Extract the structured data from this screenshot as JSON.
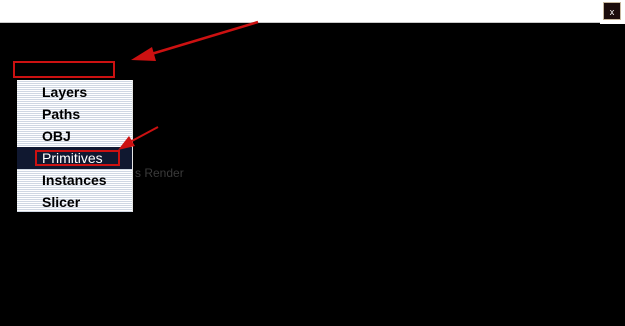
{
  "window": {
    "close_label": "x"
  },
  "menu": {
    "items": [
      {
        "label": "Layers",
        "selected": false
      },
      {
        "label": "Paths",
        "selected": false
      },
      {
        "label": "OBJ",
        "selected": false
      },
      {
        "label": "Primitives",
        "selected": true
      },
      {
        "label": "Instances",
        "selected": false
      },
      {
        "label": "Slicer",
        "selected": false
      }
    ]
  },
  "background": {
    "partial_text": "s Render"
  },
  "colors": {
    "annotation": "#cc1111",
    "background": "#000000",
    "selected_item_bg": "#101830"
  }
}
